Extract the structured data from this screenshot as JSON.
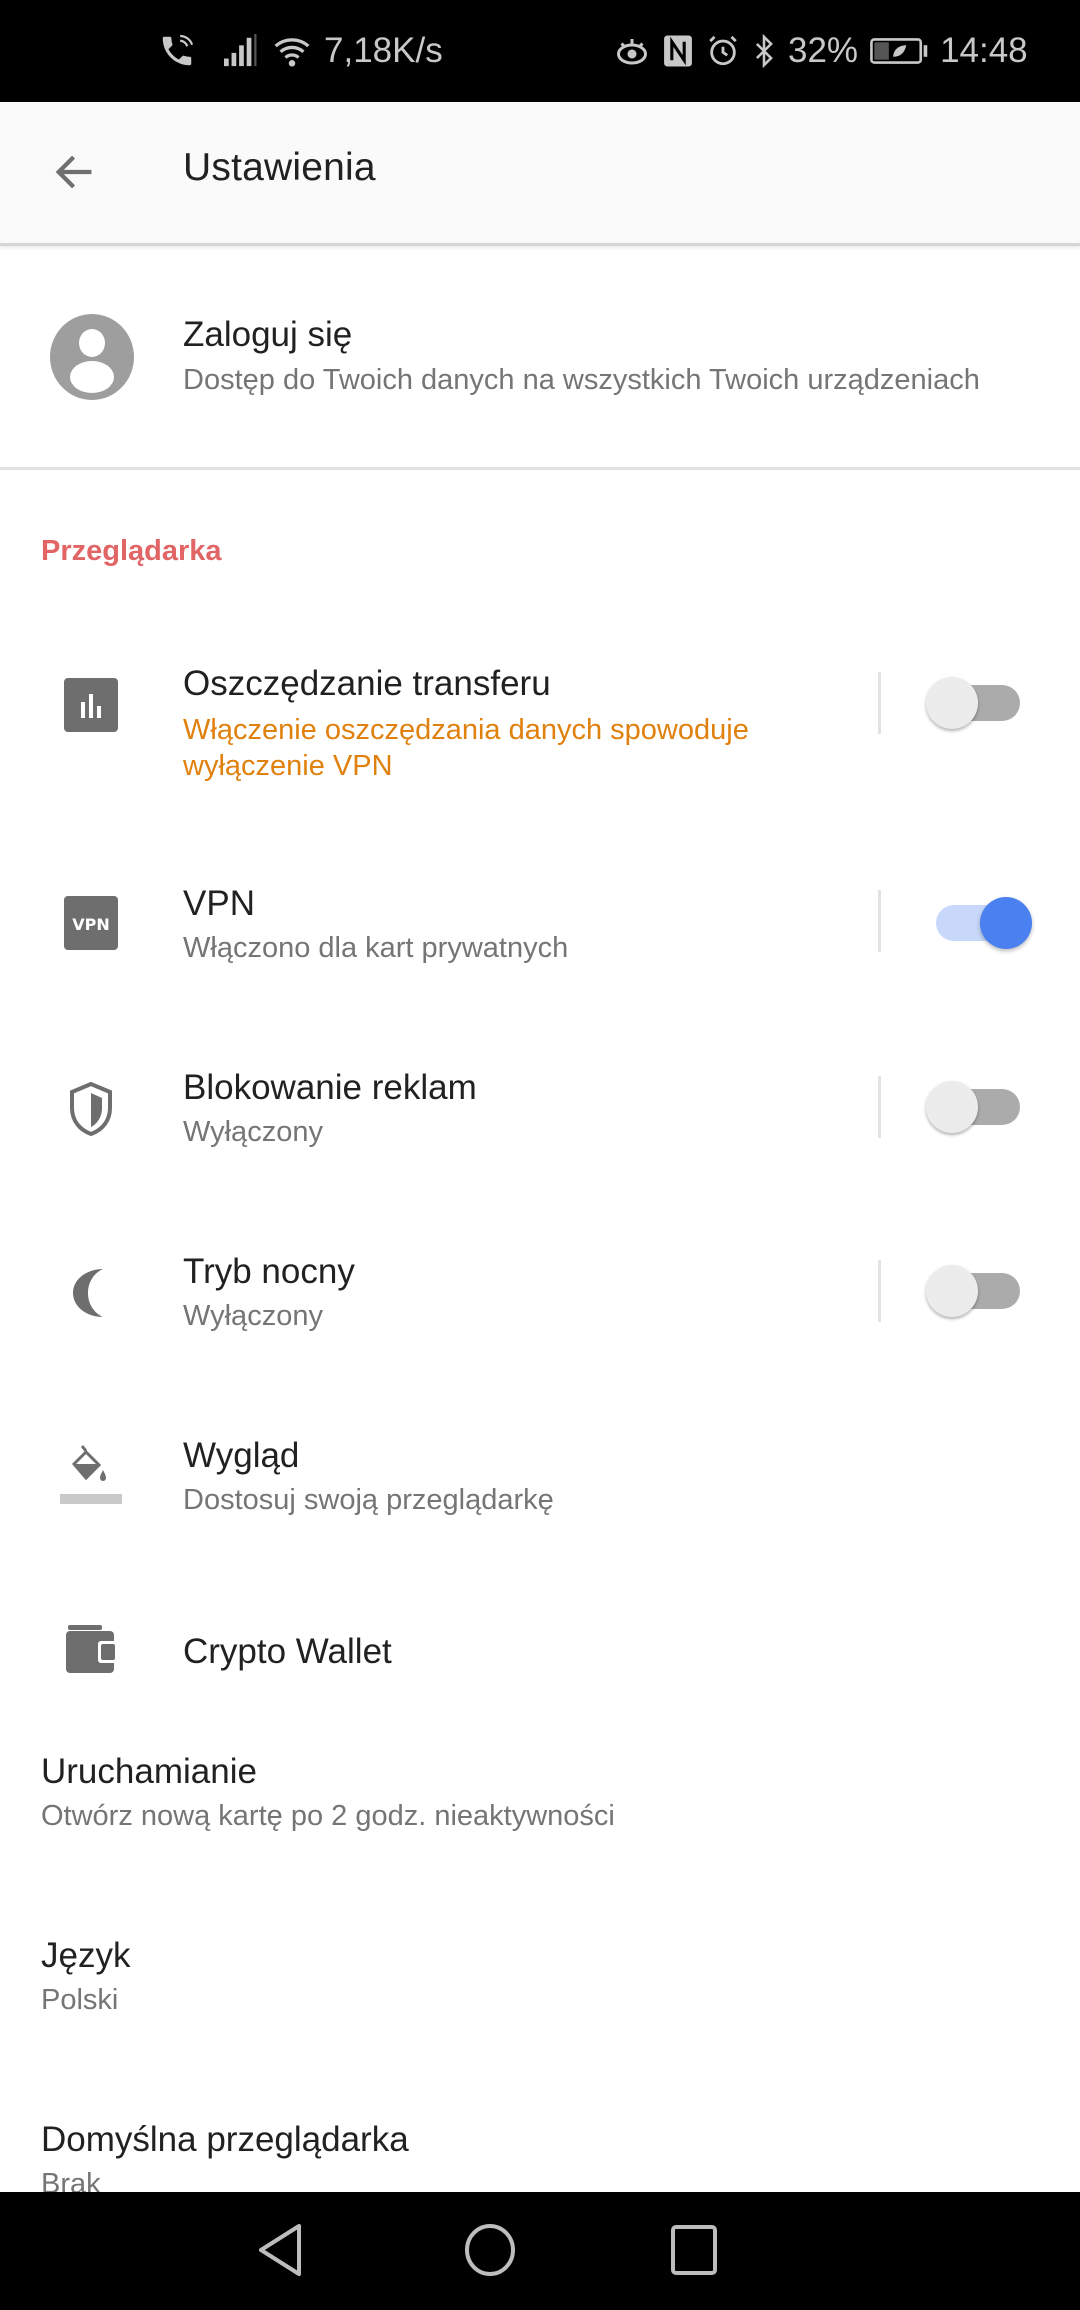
{
  "status_bar": {
    "network_speed": "7,18K/s",
    "battery_percent": "32%",
    "time": "14:48",
    "icons_left": [
      "wifi-calling-icon",
      "signal-icon",
      "wifi-icon"
    ],
    "icons_right": [
      "eye-comfort-icon",
      "nfc-icon",
      "alarm-icon",
      "bluetooth-icon",
      "battery-saver-icon"
    ]
  },
  "app_bar": {
    "title": "Ustawienia",
    "back_icon": "arrow-back-icon"
  },
  "account": {
    "title": "Zaloguj się",
    "subtitle": "Dostęp do Twoich danych na wszystkich Twoich urządzeniach",
    "icon": "account-circle-icon"
  },
  "section": {
    "header": "Przeglądarka",
    "header_color": "#e26566"
  },
  "settings": [
    {
      "title": "Oszczędzanie transferu",
      "subtitle": "Włączenie oszczędzania danych spowoduje wyłączenie VPN",
      "subtitle_color": "#e0810e",
      "icon": "data-savings-icon",
      "toggle": false
    },
    {
      "title": "VPN",
      "subtitle": "Włączono dla kart prywatnych",
      "icon": "vpn-icon",
      "icon_label": "VPN",
      "toggle": true
    },
    {
      "title": "Blokowanie reklam",
      "subtitle": "Wyłączony",
      "icon": "shield-icon",
      "toggle": false
    },
    {
      "title": "Tryb nocny",
      "subtitle": "Wyłączony",
      "icon": "moon-icon",
      "toggle": false
    },
    {
      "title": "Wygląd",
      "subtitle": "Dostosuj swoją przeglądarkę",
      "icon": "paint-bucket-icon"
    },
    {
      "title": "Crypto Wallet",
      "icon": "wallet-icon"
    }
  ],
  "plain_settings": [
    {
      "title": "Uruchamianie",
      "subtitle": "Otwórz nową kartę po 2 godz. nieaktywności"
    },
    {
      "title": "Język",
      "subtitle": "Polski"
    },
    {
      "title": "Domyślna przeglądarka",
      "subtitle": "Brak"
    }
  ],
  "colors": {
    "toggle_on": "#4a80f0",
    "toggle_on_track": "#c7d8fb",
    "toggle_off_track": "#ababab",
    "toggle_off_thumb": "#ececec",
    "icon_gray": "#6e6e6e"
  },
  "nav_bar": {
    "buttons": [
      "nav-back-icon",
      "nav-home-icon",
      "nav-recents-icon"
    ]
  }
}
